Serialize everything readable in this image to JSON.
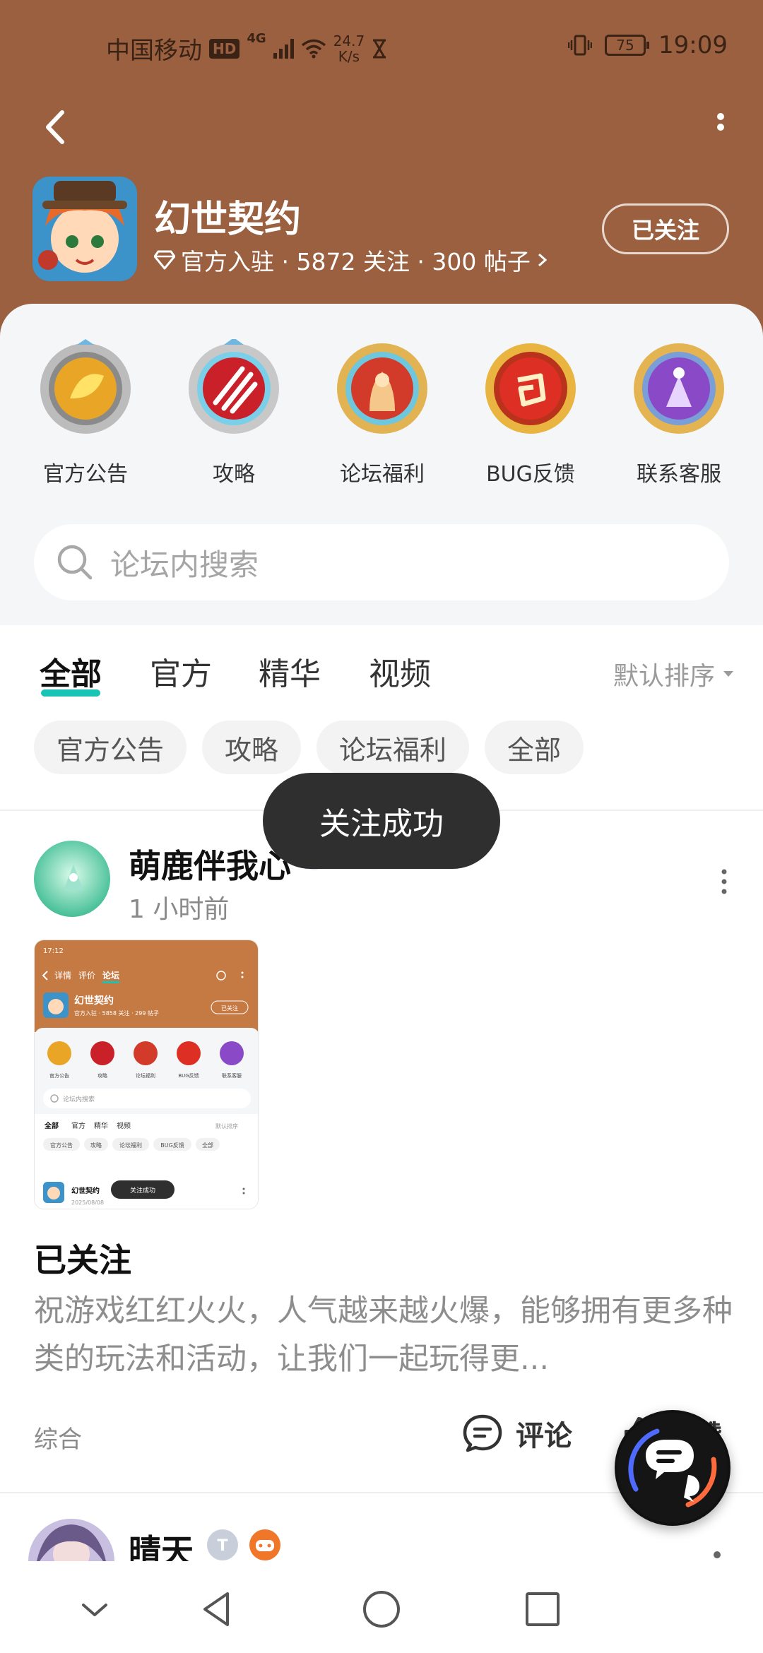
{
  "status_bar": {
    "carrier": "中国移动",
    "hd": "HD",
    "network": "4G",
    "speed_value": "24.7",
    "speed_unit": "K/s",
    "battery": "75",
    "time": "19:09"
  },
  "forum": {
    "title": "幻世契约",
    "meta": "官方入驻 · 5872 关注 · 300 帖子",
    "follow_label": "已关注"
  },
  "quick_links": [
    {
      "label": "官方公告"
    },
    {
      "label": "攻略"
    },
    {
      "label": "论坛福利"
    },
    {
      "label": "BUG反馈"
    },
    {
      "label": "联系客服"
    }
  ],
  "search": {
    "placeholder": "论坛内搜索"
  },
  "tabs": [
    {
      "label": "全部",
      "active": true
    },
    {
      "label": "官方"
    },
    {
      "label": "精华"
    },
    {
      "label": "视频"
    }
  ],
  "sort": {
    "label": "默认排序"
  },
  "chips": [
    {
      "label": "官方公告"
    },
    {
      "label": "攻略"
    },
    {
      "label": "论坛福利"
    },
    {
      "label": "全部"
    }
  ],
  "post": {
    "author": "萌鹿伴我心",
    "time": "1 小时前",
    "title": "已关注",
    "body": "祝游戏红红火火，人气越来越火爆，能够拥有更多种类的玩法和活动，让我们一起玩得更...",
    "tag": "综合",
    "comment_label": "评论",
    "like_label": "点赞",
    "thumb": {
      "status_time": "17:12",
      "tabs": [
        "详情",
        "评价",
        "论坛"
      ],
      "forum_title": "幻世契约",
      "forum_meta": "官方入驻 · 5858 关注 · 299 帖子",
      "follow_label": "已关注",
      "icons": [
        "官方公告",
        "攻略",
        "论坛福利",
        "BUG反馈",
        "联系客服"
      ],
      "search": "论坛内搜索",
      "sub_tabs": [
        "全部",
        "官方",
        "精华",
        "视频"
      ],
      "sort": "默认排序",
      "chips": [
        "官方公告",
        "攻略",
        "论坛福利",
        "BUG反馈",
        "全部"
      ],
      "post_author": "幻世契约",
      "post_date": "2025/08/08",
      "toast": "关注成功"
    }
  },
  "post2": {
    "author": "晴天"
  },
  "toast": {
    "text": "关注成功"
  },
  "colors": {
    "header": "#9a6040",
    "accent": "#1bc3b5",
    "toast_bg": "#2f2f2f"
  }
}
